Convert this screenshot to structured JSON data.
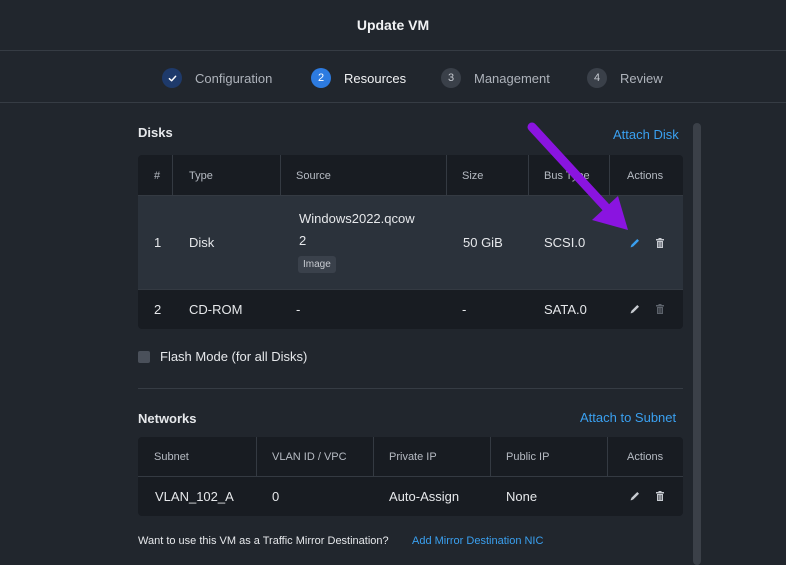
{
  "dialog": {
    "title": "Update VM"
  },
  "steps": [
    {
      "number": "✓",
      "label": "Configuration",
      "state": "done"
    },
    {
      "number": "2",
      "label": "Resources",
      "state": "active"
    },
    {
      "number": "3",
      "label": "Management",
      "state": "pending"
    },
    {
      "number": "4",
      "label": "Review",
      "state": "pending"
    }
  ],
  "disks": {
    "title": "Disks",
    "attach_label": "Attach Disk",
    "columns": [
      "#",
      "Type",
      "Source",
      "Size",
      "Bus Type",
      "Actions"
    ],
    "rows": [
      {
        "num": "1",
        "type": "Disk",
        "source_line1": "Windows2022.qcow",
        "source_line2": "2",
        "source_badge": "Image",
        "size": "50 GiB",
        "bus": "SCSI.0"
      },
      {
        "num": "2",
        "type": "CD-ROM",
        "source_line1": "-",
        "size": "-",
        "bus": "SATA.0"
      }
    ]
  },
  "flash_mode": {
    "label": "Flash Mode (for all Disks)",
    "checked": false
  },
  "networks": {
    "title": "Networks",
    "attach_label": "Attach to Subnet",
    "columns": [
      "Subnet",
      "VLAN ID / VPC",
      "Private IP",
      "Public IP",
      "Actions"
    ],
    "rows": [
      {
        "subnet": "VLAN_102_A",
        "vlan": "0",
        "private_ip": "Auto-Assign",
        "public_ip": "None"
      }
    ]
  },
  "footer": {
    "prompt": "Want to use this VM as a Traffic Mirror Destination?",
    "link": "Add Mirror Destination NIC"
  },
  "colors": {
    "background": "#21262d",
    "table_bg": "#181c22",
    "accent_link": "#3aa0f0",
    "active_step": "#2d7be0",
    "annotation_arrow": "#8a14e0"
  },
  "icons": [
    "checkmark-icon",
    "pencil-icon",
    "trash-icon"
  ]
}
